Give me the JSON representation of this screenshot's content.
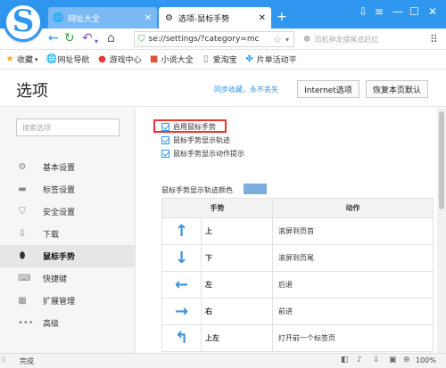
{
  "window": {
    "logo_letter": "S",
    "tabs": [
      {
        "label": "网址大全",
        "icon": "globe-icon",
        "active": false
      },
      {
        "label": "选项-鼠标手势",
        "icon": "gear-icon",
        "active": true
      }
    ],
    "new_tab_symbol": "+",
    "controls": [
      "⇩",
      "≡",
      "—",
      "☐",
      "✕"
    ]
  },
  "addressbar": {
    "url": "se://settings/?category=mc",
    "search_placeholder": "司机神龙摆尾追赶红"
  },
  "bookmarks": [
    {
      "label": "收藏",
      "icon": "star-icon"
    },
    {
      "label": "网址导航",
      "icon": "globe-icon"
    },
    {
      "label": "游戏中心",
      "icon": "game-icon"
    },
    {
      "label": "小说大全",
      "icon": "book-icon"
    },
    {
      "label": "爱淘宝",
      "icon": "page-icon"
    },
    {
      "label": "片单活动平",
      "icon": "puzzle-icon"
    }
  ],
  "header": {
    "title": "选项",
    "sync_link": "同步收藏，永不丢失",
    "internet_options": "Internet选项",
    "restore_defaults": "恢复本页默认"
  },
  "sidebar": {
    "search_placeholder": "搜索选项",
    "items": [
      {
        "label": "基本设置",
        "icon": "gear-icon",
        "active": false
      },
      {
        "label": "标签设置",
        "icon": "tab-icon",
        "active": false
      },
      {
        "label": "安全设置",
        "icon": "shield-icon",
        "active": false
      },
      {
        "label": "下载",
        "icon": "download-icon",
        "active": false
      },
      {
        "label": "鼠标手势",
        "icon": "mouse-icon",
        "active": true
      },
      {
        "label": "快捷键",
        "icon": "keyboard-icon",
        "active": false
      },
      {
        "label": "扩展管理",
        "icon": "extension-icon",
        "active": false
      },
      {
        "label": "高级",
        "icon": "more-icon",
        "active": false
      }
    ]
  },
  "content": {
    "checkboxes": [
      {
        "label": "启用鼠标手势",
        "checked": true
      },
      {
        "label": "鼠标手势显示轨迹",
        "checked": true
      },
      {
        "label": "鼠标手势显示动作提示",
        "checked": true
      }
    ],
    "trail_color_label": "鼠标手势显示轨迹颜色",
    "trail_color": "#7cace0",
    "table_headers": [
      "手势",
      "动作"
    ],
    "gestures": [
      {
        "arrow": "↑",
        "direction": "上",
        "action": "滚屏到页首"
      },
      {
        "arrow": "↓",
        "direction": "下",
        "action": "滚屏到页尾"
      },
      {
        "arrow": "←",
        "direction": "左",
        "action": "后退"
      },
      {
        "arrow": "→",
        "direction": "右",
        "action": "前进"
      },
      {
        "arrow": "↰",
        "direction": "上左",
        "action": "打开前一个标签页"
      }
    ]
  },
  "status": {
    "text": "完成",
    "zoom": "100%"
  },
  "colors": {
    "accent": "#2f97ef",
    "highlight_border": "#ee3333"
  }
}
